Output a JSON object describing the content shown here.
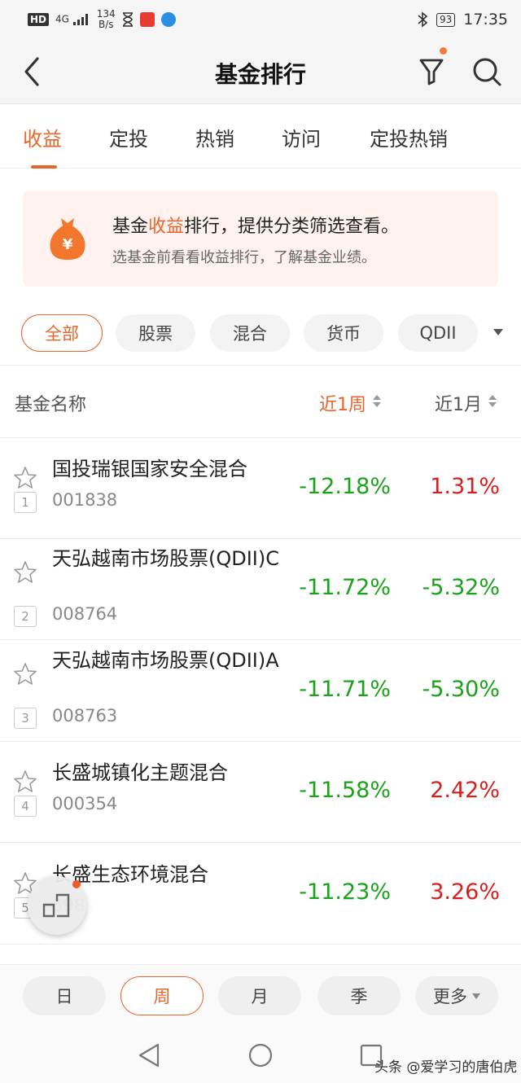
{
  "status_bar": {
    "hd": "HD",
    "network": "4G",
    "speed_value": "134",
    "speed_unit": "B/s",
    "battery": "93",
    "time": "17:35"
  },
  "navbar": {
    "title": "基金排行"
  },
  "tabs": [
    "收益",
    "定投",
    "热销",
    "访问",
    "定投热销"
  ],
  "banner": {
    "line1_prefix": "基金",
    "line1_highlight": "收益",
    "line1_suffix": "排行，提供分类筛选查看。",
    "line2": "选基金前看看收益排行，了解基金业绩。"
  },
  "filters": [
    "全部",
    "股票",
    "混合",
    "货币",
    "QDII"
  ],
  "table_header": {
    "name": "基金名称",
    "week": "近1周",
    "month": "近1月"
  },
  "funds": [
    {
      "rank": "1",
      "name": "国投瑞银国家安全混合",
      "code": "001838",
      "week": "-12.18%",
      "month": "1.31%"
    },
    {
      "rank": "2",
      "name": "天弘越南市场股票(QDII)C",
      "code": "008764",
      "week": "-11.72%",
      "month": "-5.32%"
    },
    {
      "rank": "3",
      "name": "天弘越南市场股票(QDII)A",
      "code": "008763",
      "week": "-11.71%",
      "month": "-5.30%"
    },
    {
      "rank": "4",
      "name": "长盛城镇化主题混合",
      "code": "000354",
      "week": "-11.58%",
      "month": "2.42%"
    },
    {
      "rank": "5",
      "name": "长盛生态环境混合",
      "code": "598",
      "week": "-11.23%",
      "month": "3.26%"
    }
  ],
  "periods": [
    "日",
    "周",
    "月",
    "季",
    "更多"
  ],
  "watermark": "头条 @爱学习的唐伯虎",
  "colors": {
    "accent": "#e8662c",
    "negative": "#1aa31a",
    "positive": "#d62020"
  }
}
